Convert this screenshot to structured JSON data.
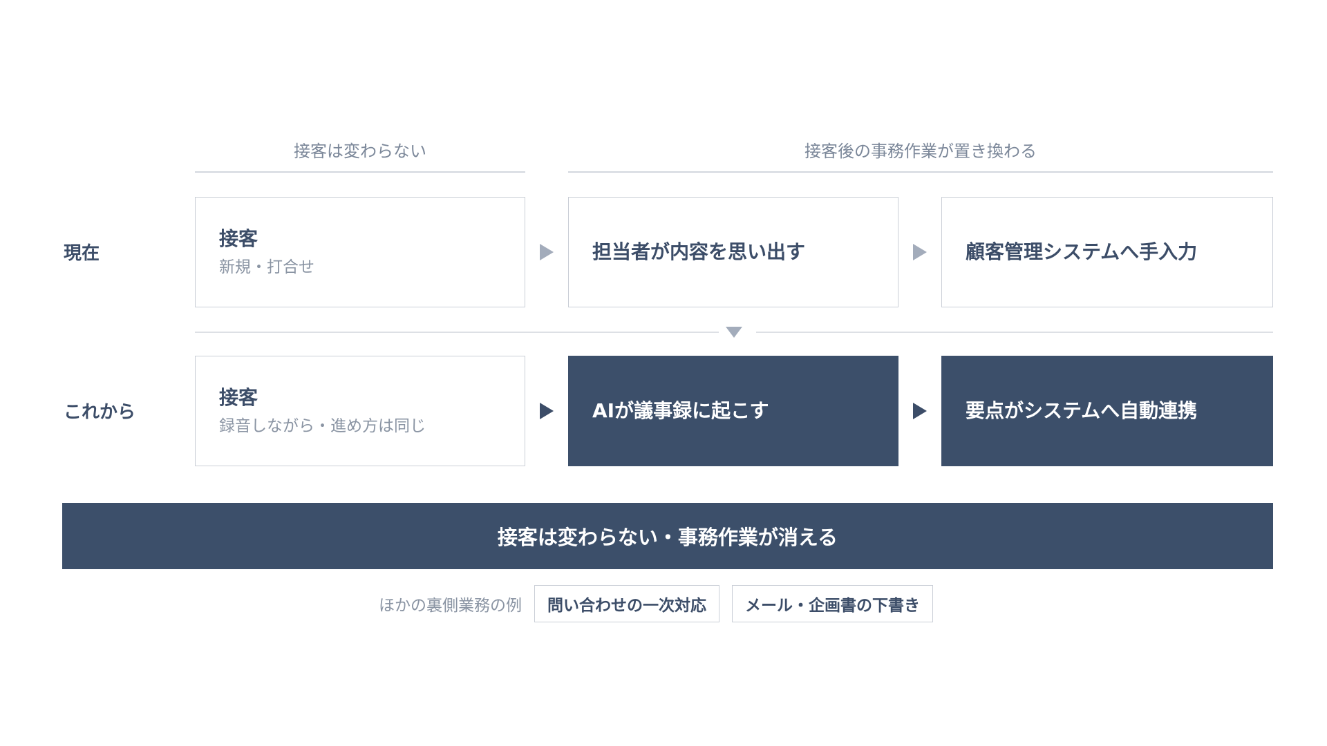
{
  "header": {
    "left_group": "接客は変わらない",
    "right_group": "接客後の事務作業が置き換わる"
  },
  "current": {
    "label": "現在",
    "step1": {
      "title": "接客",
      "sub": "新規・打合せ"
    },
    "step2": {
      "title": "担当者が内容を思い出す"
    },
    "step3": {
      "title": "顧客管理システムへ手入力"
    }
  },
  "future": {
    "label": "これから",
    "step1": {
      "title": "接客",
      "sub": "録音しながら・進め方は同じ"
    },
    "step2": {
      "title": "AIが議事録に起こす"
    },
    "step3": {
      "title": "要点がシステムへ自動連携"
    }
  },
  "banner": {
    "text": "接客は変わらない・事務作業が消える"
  },
  "examples": {
    "label": "ほかの裏側業務の例",
    "items": [
      "問い合わせの一次対応",
      "メール・企画書の下書き"
    ]
  },
  "colors": {
    "navy": "#3c4f6a",
    "text": "#3c4d68",
    "muted": "#8a94a3",
    "border": "#c9ced6",
    "arrow_light": "#a3acbb"
  }
}
